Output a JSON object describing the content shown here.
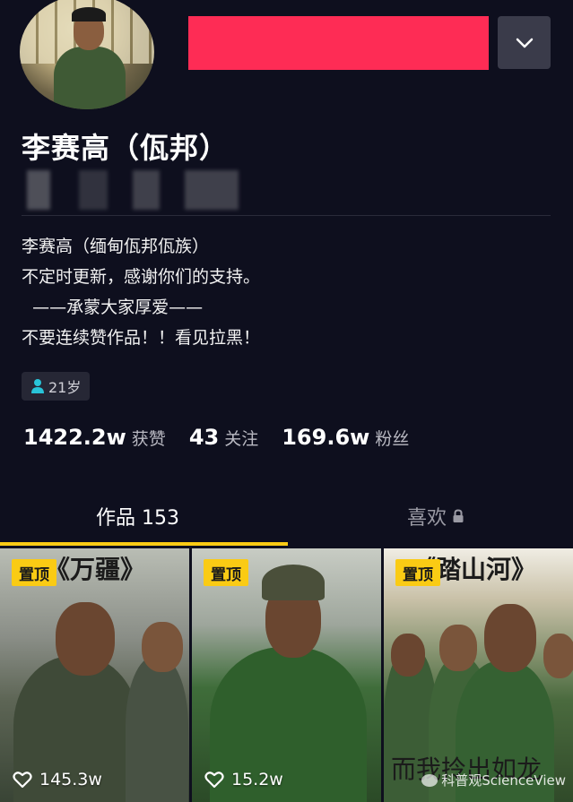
{
  "header": {
    "nickname": "李赛高（佤邦）"
  },
  "bio": {
    "lines": [
      "李赛高（缅甸佤邦佤族）",
      "不定时更新，感谢你们的支持。",
      "  ——承蒙大家厚爱——",
      "不要连续赞作品！！看见拉黑！"
    ]
  },
  "profile_tag": {
    "age": "21岁"
  },
  "stats": [
    {
      "num": "1422.2w",
      "label": "获赞"
    },
    {
      "num": "43",
      "label": "关注"
    },
    {
      "num": "169.6w",
      "label": "粉丝"
    }
  ],
  "tabs": {
    "works": "作品 153",
    "likes": "喜欢"
  },
  "videos": [
    {
      "pinned": "置顶",
      "banner": "《万疆》",
      "likes": "145.3w"
    },
    {
      "pinned": "置顶",
      "banner": "",
      "likes": "15.2w"
    },
    {
      "pinned": "置顶",
      "banner": "《踏山河》",
      "likes": "",
      "subtitle": "而我拎出如龙"
    }
  ],
  "watermark": "科普观ScienceView",
  "colors": {
    "background": "#0e0f1e",
    "accent": "#facb14",
    "redaction": "#fe2c55"
  },
  "icons": [
    "chevron-down-icon",
    "person-icon",
    "lock-icon",
    "heart-icon"
  ]
}
